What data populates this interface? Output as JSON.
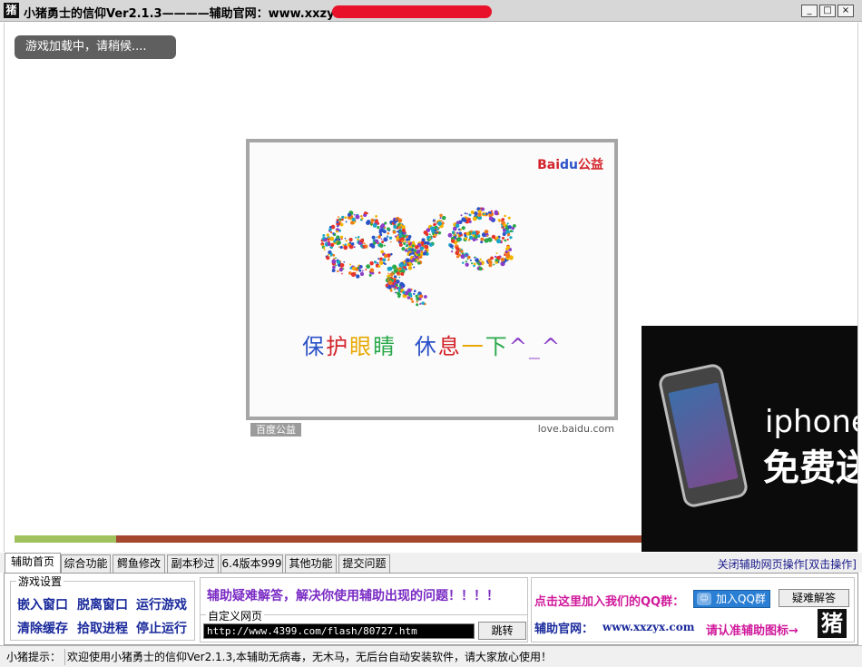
{
  "window": {
    "title": "小猪勇士的信仰Ver2.1.3————辅助官网：www.xxzyx.com",
    "icon_glyph": "猪",
    "buttons": [
      "_",
      "□",
      "×"
    ]
  },
  "game": {
    "loading_text": "游戏加载中，请稍候....",
    "progress_fraction": 0.16
  },
  "baidu_ad": {
    "logo_text": "Bai",
    "logo_paw": "du",
    "logo_suffix": "公益",
    "slogan": [
      "保",
      "护",
      "眼",
      "睛",
      " ",
      "休",
      "息",
      "一",
      "下",
      "^_^"
    ],
    "footer_tag": "百度公益",
    "footer_url": "love.baidu.com",
    "colors": [
      "#2b52c8",
      "#d3232a",
      "#e8a800",
      "#2aa84a",
      "#8a3cc8"
    ]
  },
  "phone_ad": {
    "line1": "iphone",
    "line2": "免费送"
  },
  "tabs": [
    {
      "label": "辅助首页",
      "active": true
    },
    {
      "label": "综合功能",
      "active": false
    },
    {
      "label": "鳄鱼修改",
      "active": false
    },
    {
      "label": "副本秒过",
      "active": false
    },
    {
      "label": "6.4版本999",
      "active": false
    },
    {
      "label": "其他功能",
      "active": false
    },
    {
      "label": "提交问题",
      "active": false
    }
  ],
  "close_ops_label": "关闭辅助网页操作[双击操作]",
  "panel": {
    "game_settings": {
      "legend": "游戏设置",
      "buttons": [
        "嵌入窗口",
        "脱离窗口",
        "运行游戏",
        "清除缓存",
        "拾取进程",
        "停止运行"
      ]
    },
    "help_text": "辅助疑难解答，解决你使用辅助出现的问题！！！！",
    "custom_page": {
      "legend": "自定义网页",
      "url_value": "http://www.4399.com/flash/80727.htm",
      "go_button": "跳转"
    },
    "qq": {
      "prompt": "点击这里加入我们的QQ群：",
      "join_button": "加入QQ群",
      "faq_button": "疑难解答"
    },
    "official": {
      "label": "辅助官网：",
      "url": "www.xxzyx.com",
      "note": "请认准辅助图标→",
      "icon_glyph": "猪"
    }
  },
  "status": {
    "label": "小猪提示：",
    "message": "欢迎使用小猪勇士的信仰Ver2.1.3,本辅助无病毒，无木马，无后台自动安装软件，请大家放心使用！"
  }
}
